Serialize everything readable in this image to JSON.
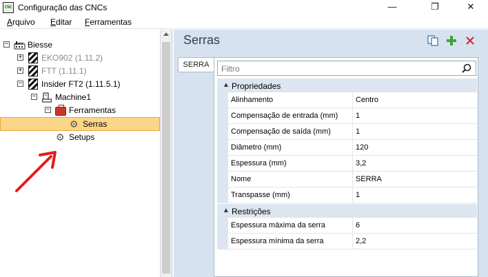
{
  "window": {
    "app_icon_text": "CNC",
    "title": "Configuração das CNCs",
    "minimize_glyph": "—",
    "maximize_glyph": "❐",
    "close_glyph": "✕"
  },
  "menu": {
    "items": [
      {
        "first": "A",
        "rest": "rquivo"
      },
      {
        "first": "E",
        "rest": "ditar"
      },
      {
        "first": "F",
        "rest": "erramentas"
      }
    ]
  },
  "tree": {
    "root": {
      "label": "Biesse",
      "expander": "−"
    },
    "nodes": [
      {
        "label": "EKO902 (1.11.2)",
        "expander": "+",
        "muted": true
      },
      {
        "label": "FTT (1.11.1)",
        "expander": "+",
        "muted": true
      },
      {
        "label": "Insider FT2 (1.11.5.1)",
        "expander": "−",
        "muted": false
      },
      {
        "label": "Machine1",
        "expander": "−",
        "muted": false
      },
      {
        "label": "Ferramentas",
        "expander": "−",
        "muted": false
      },
      {
        "label": "Serras",
        "selected": true
      },
      {
        "label": "Setups"
      }
    ]
  },
  "panel": {
    "title": "Serras",
    "tab_label": "SERRA",
    "search_placeholder": "Filtro",
    "categories": [
      {
        "label": "Propriedades",
        "rows": [
          {
            "name": "Alinhamento",
            "value": "Centro"
          },
          {
            "name": "Compensação de entrada (mm)",
            "value": "1"
          },
          {
            "name": "Compensação de saída (mm)",
            "value": "1"
          },
          {
            "name": "Diâmetro (mm)",
            "value": "120"
          },
          {
            "name": "Espessura (mm)",
            "value": "3,2"
          },
          {
            "name": "Nome",
            "value": "SERRA"
          },
          {
            "name": "Transpasse (mm)",
            "value": "1"
          }
        ]
      },
      {
        "label": "Restrições",
        "rows": [
          {
            "name": "Espessura máxima da serra",
            "value": "6"
          },
          {
            "name": "Espessura mínima da serra",
            "value": "2,2"
          }
        ]
      }
    ]
  },
  "colors": {
    "selection": "#fbd58a",
    "panel_bg": "#d6e2ef",
    "add_icon": "#3fa238",
    "delete_icon": "#d32b2b",
    "copy_icon": "#3b75b9",
    "annotation_arrow": "#e11d1d"
  },
  "icons": {
    "root": "factory-icon",
    "machine_versions": "hatched-machine-icon",
    "machine": "machine-icon",
    "tools": "toolbox-icon",
    "saws": "gear-icon",
    "setups": "gear-icon"
  }
}
